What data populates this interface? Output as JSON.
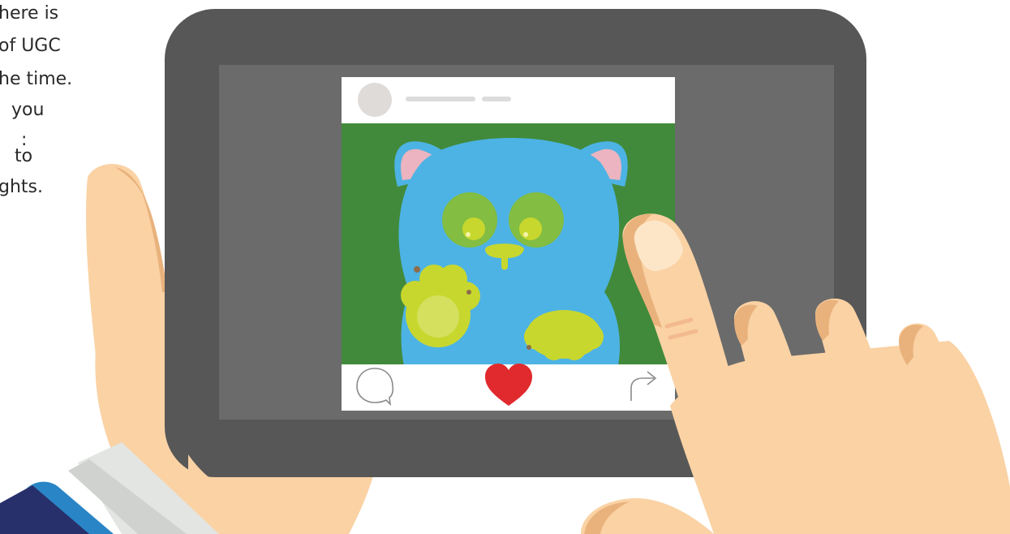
{
  "copy": {
    "line1": "here is",
    "line2": "of UGC",
    "line3": "he time.",
    "line4": "you",
    "line5": ":",
    "line6": "to",
    "line7": "ghts."
  },
  "post": {
    "header_icons": [
      "avatar",
      "username-placeholder"
    ],
    "footer_icons": [
      "comment-icon",
      "heart-icon",
      "share-icon"
    ]
  },
  "colors": {
    "tablet": "#575757",
    "screen": "#6b6b6b",
    "photo_bg": "#418a3b",
    "creature": "#4db3e4",
    "ears": "#ebb4c0",
    "eyes": "#83bd41",
    "accent_yellow": "#c8d72e",
    "heart": "#e02a2d",
    "skin": "#fad2a4",
    "skin_shadow": "#e9b27c",
    "sleeve_blue": "#2a85c6",
    "sleeve_navy": "#27306a"
  }
}
